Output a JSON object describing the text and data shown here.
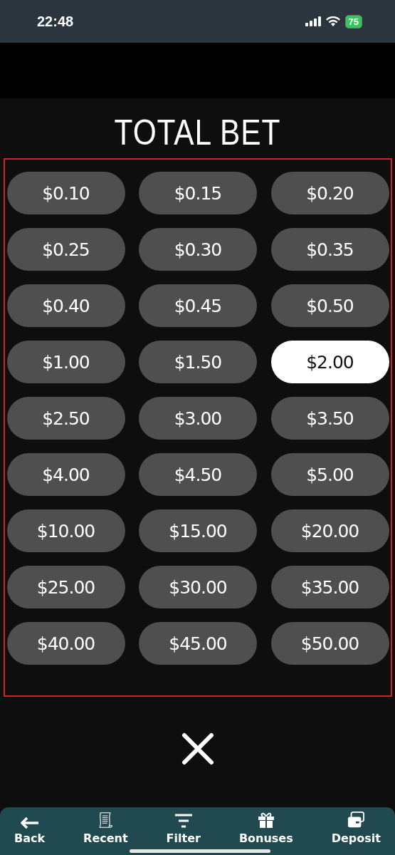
{
  "status_bar": {
    "time": "22:48",
    "battery": "75"
  },
  "title": "TOTAL BET",
  "bets": [
    {
      "amount": "$0.10",
      "selected": false
    },
    {
      "amount": "$0.15",
      "selected": false
    },
    {
      "amount": "$0.20",
      "selected": false
    },
    {
      "amount": "$0.25",
      "selected": false
    },
    {
      "amount": "$0.30",
      "selected": false
    },
    {
      "amount": "$0.35",
      "selected": false
    },
    {
      "amount": "$0.40",
      "selected": false
    },
    {
      "amount": "$0.45",
      "selected": false
    },
    {
      "amount": "$0.50",
      "selected": false
    },
    {
      "amount": "$1.00",
      "selected": false
    },
    {
      "amount": "$1.50",
      "selected": false
    },
    {
      "amount": "$2.00",
      "selected": true
    },
    {
      "amount": "$2.50",
      "selected": false
    },
    {
      "amount": "$3.00",
      "selected": false
    },
    {
      "amount": "$3.50",
      "selected": false
    },
    {
      "amount": "$4.00",
      "selected": false
    },
    {
      "amount": "$4.50",
      "selected": false
    },
    {
      "amount": "$5.00",
      "selected": false
    },
    {
      "amount": "$10.00",
      "selected": false
    },
    {
      "amount": "$15.00",
      "selected": false
    },
    {
      "amount": "$20.00",
      "selected": false
    },
    {
      "amount": "$25.00",
      "selected": false
    },
    {
      "amount": "$30.00",
      "selected": false
    },
    {
      "amount": "$35.00",
      "selected": false
    },
    {
      "amount": "$40.00",
      "selected": false
    },
    {
      "amount": "$45.00",
      "selected": false
    },
    {
      "amount": "$50.00",
      "selected": false
    }
  ],
  "nav": [
    {
      "label": "Back",
      "kind": "back"
    },
    {
      "label": "Recent",
      "kind": "recent"
    },
    {
      "label": "Filter",
      "kind": "filter"
    },
    {
      "label": "Bonuses",
      "kind": "bonuses"
    },
    {
      "label": "Deposit",
      "kind": "deposit"
    }
  ]
}
